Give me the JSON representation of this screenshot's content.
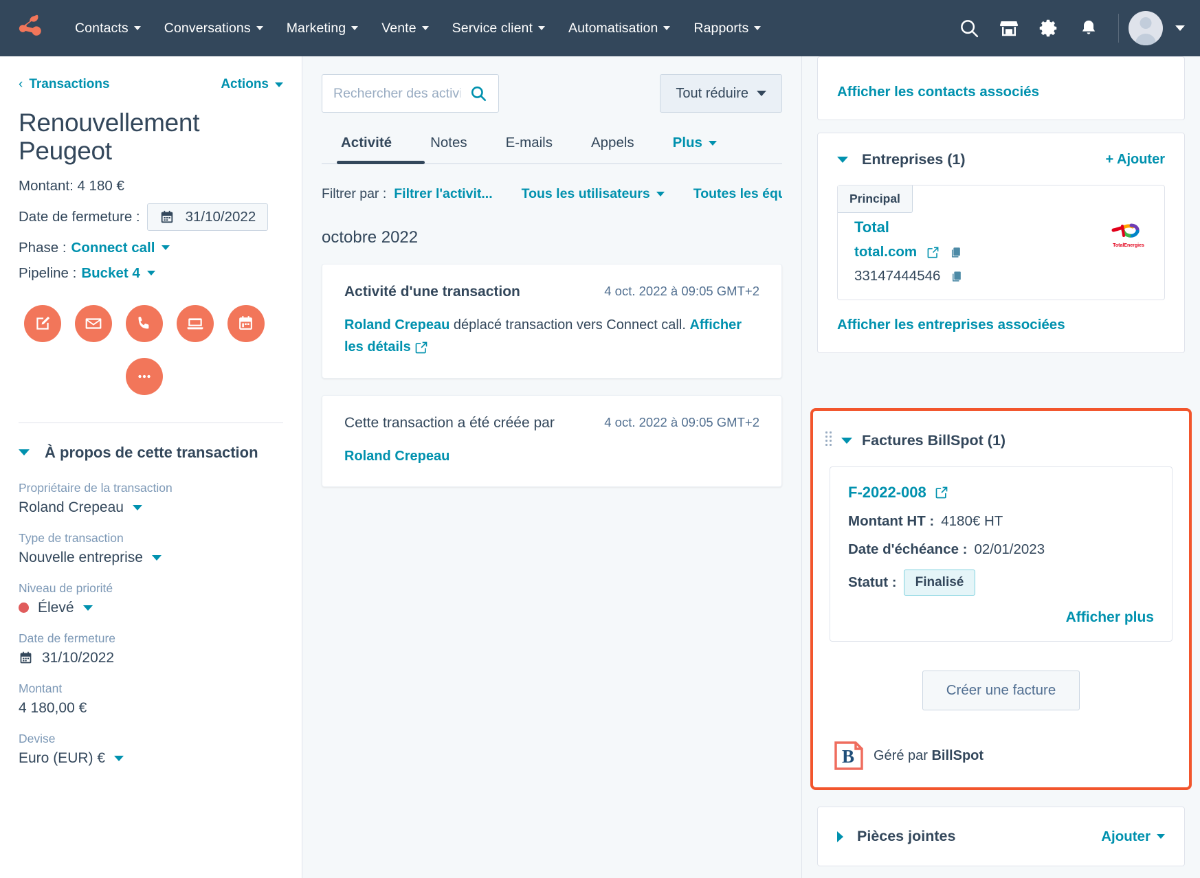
{
  "topnav": {
    "logo_name": "hubspot-logo",
    "menu": [
      {
        "label": "Contacts"
      },
      {
        "label": "Conversations"
      },
      {
        "label": "Marketing"
      },
      {
        "label": "Vente"
      },
      {
        "label": "Service client"
      },
      {
        "label": "Automatisation"
      },
      {
        "label": "Rapports"
      }
    ],
    "icons": [
      "search-icon",
      "marketplace-icon",
      "settings-gear-icon",
      "notifications-bell-icon"
    ],
    "bg_color": "#33475b"
  },
  "sidebar": {
    "breadcrumb": "Transactions",
    "actions_label": "Actions",
    "deal_title": "Renouvellement Peugeot",
    "amount_line": "Montant: 4 180 €",
    "close_date_label": "Date de fermeture :",
    "close_date_value": "31/10/2022",
    "phase_label": "Phase :",
    "phase_value": "Connect call",
    "pipeline_label": "Pipeline :",
    "pipeline_value": "Bucket 4",
    "quick_actions": [
      "note-icon",
      "email-icon",
      "phone-icon",
      "meeting-icon",
      "task-icon",
      "more-ellipsis-icon"
    ],
    "about_section_title": "À propos de cette transaction",
    "fields": [
      {
        "label": "Propriétaire de la transaction",
        "value": "Roland Crepeau",
        "dropdown": true
      },
      {
        "label": "Type de transaction",
        "value": "Nouvelle entreprise",
        "dropdown": true
      },
      {
        "label": "Niveau de priorité",
        "value": "Élevé",
        "dropdown": true,
        "dot": "#e05c5c"
      },
      {
        "label": "Date de fermeture",
        "value": "31/10/2022",
        "dropdown": false,
        "calendar": true
      },
      {
        "label": "Montant",
        "value": "4 180,00 €",
        "dropdown": false
      },
      {
        "label": "Devise",
        "value": "Euro (EUR) €",
        "dropdown": true
      }
    ]
  },
  "center": {
    "search_placeholder": "Rechercher des activités",
    "search_value": "",
    "collapse_all_label": "Tout réduire",
    "tabs": [
      {
        "label": "Activité",
        "active": true
      },
      {
        "label": "Notes",
        "active": false
      },
      {
        "label": "E-mails",
        "active": false
      },
      {
        "label": "Appels",
        "active": false
      },
      {
        "label": "Plus",
        "active": false,
        "dropdown": true
      }
    ],
    "filter_label": "Filtrer par :",
    "filters": [
      {
        "label": "Filtrer l'activit...",
        "dropdown": false
      },
      {
        "label": "Tous les utilisateurs",
        "dropdown": true
      },
      {
        "label": "Toutes les équipes",
        "dropdown": true
      }
    ],
    "month_label": "octobre 2022",
    "activities": [
      {
        "title": "Activité d'une transaction",
        "title_bold": true,
        "timestamp": "4 oct. 2022 à 09:05 GMT+2",
        "body_link": "Roland Crepeau",
        "body_text": " déplacé transaction vers Connect call. ",
        "body_link2": "Afficher les détails"
      },
      {
        "title": "Cette transaction a été créée par",
        "title_bold": false,
        "timestamp": "4 oct. 2022 à 09:05 GMT+2",
        "body_link": "Roland Crepeau",
        "body_text": "",
        "body_link2": ""
      }
    ]
  },
  "right": {
    "view_contacts_link": "Afficher les contacts associés",
    "companies": {
      "title": "Entreprises (1)",
      "add_label": "+ Ajouter",
      "badge": "Principal",
      "name": "Total",
      "website": "total.com",
      "phone": "33147444546",
      "logo_name": "totalenergies-logo",
      "view_link": "Afficher les entreprises associées"
    },
    "billspot": {
      "title": "Factures BillSpot (1)",
      "highlight_color": "#f2552c",
      "invoice_ref": "F-2022-008",
      "amount_label": "Montant HT :",
      "amount_value": "4180€ HT",
      "due_label": "Date d'échéance :",
      "due_value": "02/01/2023",
      "status_label": "Statut :",
      "status_value": "Finalisé",
      "show_more": "Afficher plus",
      "create_button": "Créer une facture",
      "footer_prefix": "Géré par ",
      "footer_brand": "BillSpot"
    },
    "attachments": {
      "title": "Pièces jointes",
      "add_label": "Ajouter"
    }
  }
}
